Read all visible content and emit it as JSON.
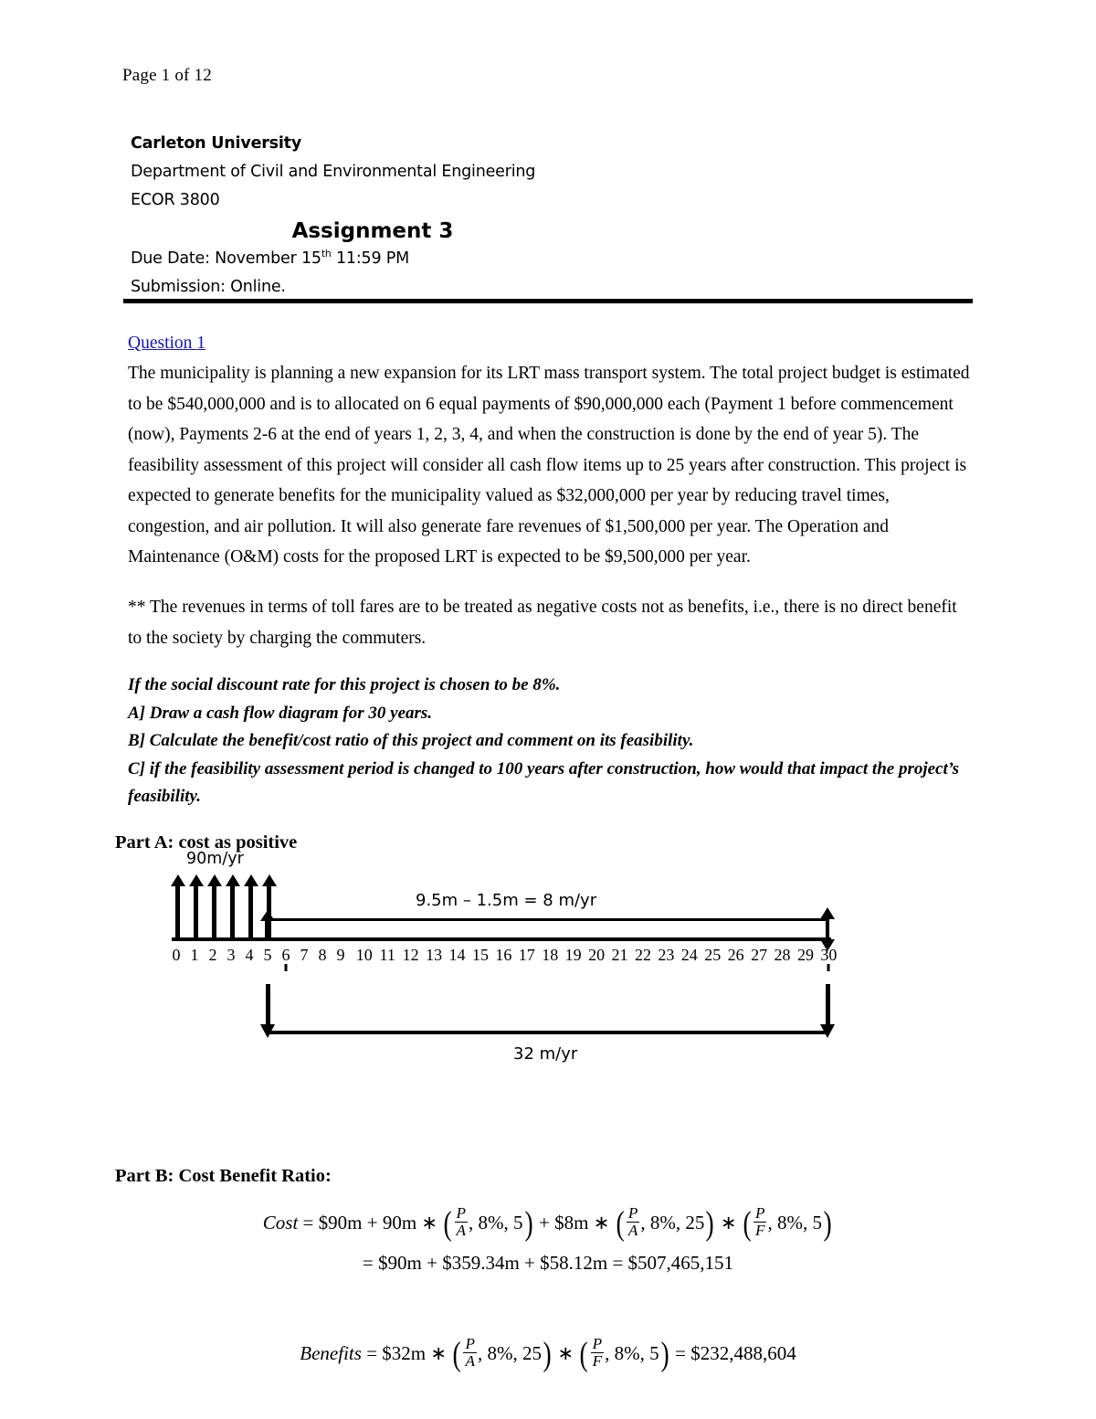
{
  "header": {
    "page_number": "Page 1 of 12"
  },
  "institution": {
    "university": "Carleton University",
    "department": "Department of Civil and Environmental Engineering",
    "course_code": "ECOR 3800",
    "assignment_title": "Assignment 3",
    "due_date_prefix": "Due Date: November 15",
    "due_date_sup": "th",
    "due_date_suffix": " 11:59 PM",
    "submission": "Submission: Online."
  },
  "question": {
    "heading": "Question 1",
    "paragraph": "The municipality is planning a new expansion for its LRT mass transport system. The total project budget is estimated to be $540,000,000 and is to allocated on 6 equal payments of $90,000,000 each (Payment 1 before commencement (now), Payments 2-6 at the end of years 1, 2, 3, 4, and when the construction is done by the end of year 5). The feasibility assessment of this project will consider all cash flow items up to 25 years after construction. This project is expected to generate benefits for the municipality valued as $32,000,000 per year by reducing travel times, congestion, and air pollution. It will also generate fare revenues of $1,500,000 per year. The Operation and Maintenance (O&M) costs for the proposed LRT is expected to be $9,500,000 per year.",
    "note": "** The revenues in terms of toll fares are to be treated as negative costs not as benefits, i.e., there is no direct benefit to the society by charging the commuters.",
    "instructions": [
      "If the social discount rate for this project is chosen to be 8%.",
      "A] Draw a cash flow diagram for 30 years.",
      "B] Calculate the benefit/cost ratio of this project and comment on its feasibility.",
      "C] if the feasibility assessment period is changed to 100 years after construction, how would that impact the project’s feasibility."
    ]
  },
  "part_a": {
    "heading": "Part A: cost as positive",
    "diagram": {
      "cost_label": "90m/yr",
      "net_om_label": "9.5m – 1.5m = 8 m/yr",
      "benefit_label": "32 m/yr",
      "timeline_ticks": [
        "0",
        "1",
        "2",
        "3",
        "4",
        "5",
        "6",
        "7",
        "8",
        "9",
        "10",
        "11",
        "12",
        "13",
        "14",
        "15",
        "16",
        "17",
        "18",
        "19",
        "20",
        "21",
        "22",
        "23",
        "24",
        "25",
        "26",
        "27",
        "28",
        "29",
        "30"
      ],
      "cost_arrow_years": [
        0,
        1,
        2,
        3,
        4,
        5
      ],
      "om_start_year": 6,
      "om_end_year": 30,
      "benefit_start_year": 6,
      "benefit_end_year": 30
    }
  },
  "part_b": {
    "heading": "Part B: Cost Benefit Ratio:",
    "cost_equation": {
      "lhs": "Cost",
      "eq": "=",
      "term1": "$90m",
      "plus1": "+",
      "term2_coeff": "90m",
      "term2_star": "∗",
      "term2_factor": {
        "num": "P",
        "den": "A",
        "rate": "8%",
        "n": "5"
      },
      "plus2": "+",
      "term3_coeff": "$8m",
      "term3_star": "∗",
      "term3_factor": {
        "num": "P",
        "den": "A",
        "rate": "8%",
        "n": "25"
      },
      "term3_star2": "∗",
      "term3_factor2": {
        "num": "P",
        "den": "F",
        "rate": "8%",
        "n": "5"
      }
    },
    "cost_result": "= $90m + $359.34m + $58.12m = $507,465,151",
    "benefit_equation": {
      "lhs": "Benefits",
      "eq": "=",
      "coeff": "$32m",
      "star1": "∗",
      "factor1": {
        "num": "P",
        "den": "A",
        "rate": "8%",
        "n": "25"
      },
      "star2": "∗",
      "factor2": {
        "num": "P",
        "den": "F",
        "rate": "8%",
        "n": "5"
      },
      "eq2": "=",
      "result": "$232,488,604"
    }
  },
  "colors": {
    "link_blue": "#1414c8",
    "text": "#000000",
    "rule": "#000000"
  }
}
